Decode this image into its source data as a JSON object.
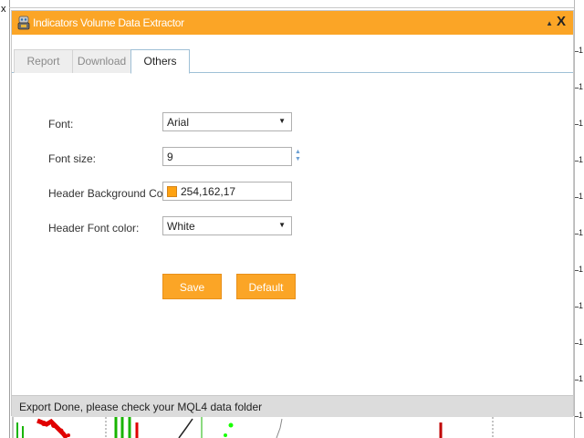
{
  "window": {
    "title": "Indicators Volume Data Extractor",
    "minimize_glyph": "▲",
    "close_glyph": "X"
  },
  "background": {
    "left_x": "x",
    "axis_labels": [
      "1",
      "1",
      "1",
      "1",
      "1",
      "1",
      "1",
      "1",
      "1",
      "1",
      "1"
    ]
  },
  "tabs": [
    {
      "label": "Report",
      "active": false
    },
    {
      "label": "Download",
      "active": false
    },
    {
      "label": "Others",
      "active": true
    }
  ],
  "form": {
    "font": {
      "label": "Font:",
      "value": "Arial"
    },
    "font_size": {
      "label": "Font size:",
      "value": "9"
    },
    "header_bg_color": {
      "label": "Header Background Color:",
      "value": "254,162,17",
      "swatch": "#fea211"
    },
    "header_font_color": {
      "label": "Header Font color:",
      "value": "White"
    }
  },
  "buttons": {
    "save": "Save",
    "default": "Default"
  },
  "status": {
    "text": "Export Done, please check your MQL4 data folder"
  },
  "colors": {
    "accent": "#fba526",
    "tab_border": "#9fc0d6",
    "status_bg": "#dcdcdc"
  }
}
